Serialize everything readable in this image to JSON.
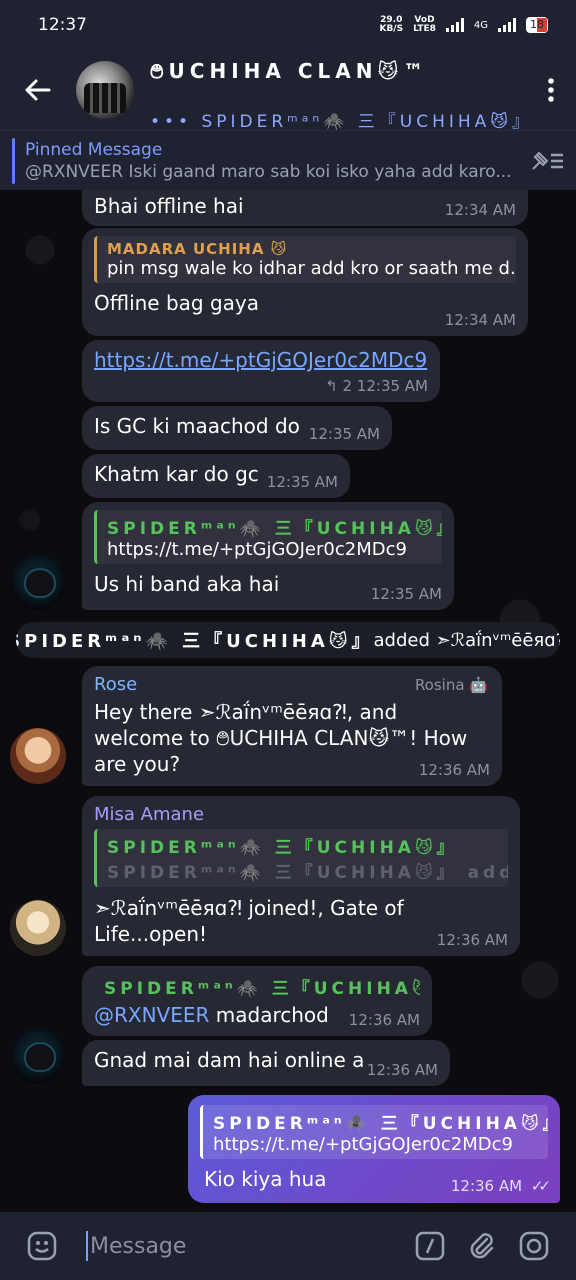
{
  "status_bar": {
    "time": "12:37",
    "net_speed_value": "29.0",
    "net_speed_unit": "KB/S",
    "vo_label": "VoD",
    "lte_label": "LTE8",
    "network": "4G",
    "battery": "18"
  },
  "header": {
    "title": "࿉UCHIHA CLAN😼™",
    "subtitle": "••• SPIDERᵐᵃⁿ🕷️ 三『UCHIHA😼』"
  },
  "pinned": {
    "title": "Pinned Message",
    "text": "@RXNVEER Iski gaand maro sab koi isko yaha add karo..."
  },
  "messages": {
    "m1": {
      "text": "Bhai offline hai",
      "time": "12:34 AM"
    },
    "m2": {
      "reply_name": "MADARA UCHIHA 😼",
      "reply_text": "pin msg wale ko idhar add kro or saath me d...",
      "text": "Offline bag gaya",
      "time": "12:34 AM"
    },
    "m3": {
      "link": "https://t.me/+ptGjGOJer0c2MDc9",
      "replies": "↰ 2",
      "time": "12:35 AM"
    },
    "m4": {
      "text": "Is GC ki maachod do",
      "time": "12:35 AM"
    },
    "m5": {
      "text": "Khatm kar do gc",
      "time": "12:35 AM"
    },
    "m6": {
      "reply_name": "SPIDERᵐᵃⁿ🕷️ 三『UCHIHA😼』",
      "reply_text": "https://t.me/+ptGjGOJer0c2MDc9",
      "text": "Us hi band aka hai",
      "time": "12:35 AM"
    },
    "service": {
      "actor": "SPIDERᵐᵃⁿ🕷️ 三『UCHIHA😼』",
      "action": " added ➣ℛaḯnᵛᵐēēяɑ⁈"
    },
    "m7": {
      "sender": "Rose",
      "tag": "Rosina 🤖",
      "text": "Hey there ➣ℛaḯnᵛᵐēēяɑ⁈, and welcome to ࿉UCHIHA CLAN😼™! How are you?",
      "time": "12:36 AM"
    },
    "m8": {
      "sender": "Misa Amane",
      "reply_name": "SPIDERᵐᵃⁿ🕷️ 三『UCHIHA😼』",
      "reply_text": "SPIDERᵐᵃⁿ🕷️ 三『UCHIHA😼』 adde...",
      "text": "➣ℛaḯnᵛᵐēēяɑ⁈ joined!, Gate of Life...open!",
      "time": "12:36 AM"
    },
    "m9": {
      "reply_name": "SPIDERᵐᵃⁿ🕷️ 三『UCHIHA😼』",
      "mention": "@RXNVEER",
      "text": " madarchod",
      "time": "12:36 AM"
    },
    "m10": {
      "text": "Gnad mai dam hai online a",
      "time": "12:36 AM"
    },
    "own": {
      "reply_name": "SPIDERᵐᵃⁿ🕷️ 三『UCHIHA😼』",
      "reply_text": "https://t.me/+ptGjGOJer0c2MDc9",
      "text": "Kio kiya hua",
      "time": "12:36 AM",
      "ticks": "✓✓"
    }
  },
  "input": {
    "placeholder": "Message"
  },
  "icons": {
    "back": "back-arrow-icon",
    "menu": "more-vertical-icon",
    "pin": "pin-list-icon",
    "emoji": "emoji-icon",
    "command": "slash-command-icon",
    "attach": "paperclip-icon",
    "camera": "camera-icon"
  },
  "colors": {
    "accent": "#7f9cff",
    "bubble_in": "#262833",
    "bubble_out": "#6f49c9",
    "reply_green": "#56c25a",
    "reply_orange": "#e0a04f"
  }
}
